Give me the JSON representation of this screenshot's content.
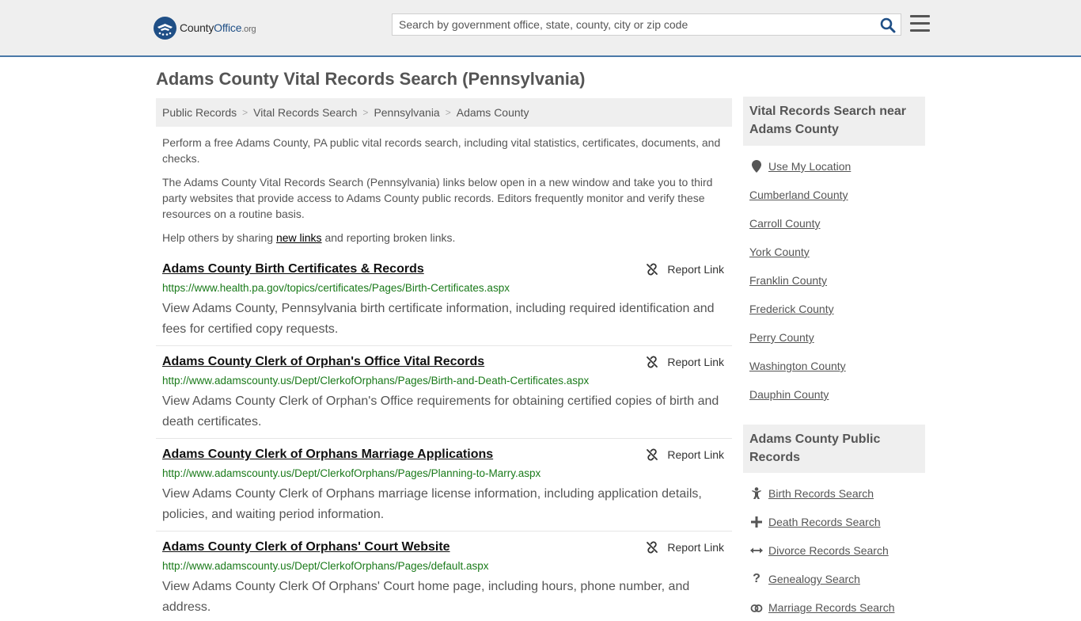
{
  "header": {
    "logo": {
      "part1": "County",
      "part2": "Office",
      "part3": ".org"
    },
    "search_placeholder": "Search by government office, state, county, city or zip code",
    "brand_color": "#1f4f86"
  },
  "page_title": "Adams County Vital Records Search (Pennsylvania)",
  "breadcrumb": [
    "Public Records",
    "Vital Records Search",
    "Pennsylvania",
    "Adams County"
  ],
  "intro": {
    "p1": "Perform a free Adams County, PA public vital records search, including vital statistics, certificates, documents, and checks.",
    "p2": "The Adams County Vital Records Search (Pennsylvania) links below open in a new window and take you to third party websites that provide access to Adams County public records. Editors frequently monitor and verify these resources on a routine basis.",
    "p3_before": "Help others by sharing ",
    "p3_link": "new links",
    "p3_after": " and reporting broken links."
  },
  "report_label": "Report Link",
  "results": [
    {
      "title": "Adams County Birth Certificates & Records",
      "url": "https://www.health.pa.gov/topics/certificates/Pages/Birth-Certificates.aspx",
      "desc": "View Adams County, Pennsylvania birth certificate information, including required identification and fees for certified copy requests."
    },
    {
      "title": "Adams County Clerk of Orphan's Office Vital Records",
      "url": "http://www.adamscounty.us/Dept/ClerkofOrphans/Pages/Birth-and-Death-Certificates.aspx",
      "desc": "View Adams County Clerk of Orphan's Office requirements for obtaining certified copies of birth and death certificates."
    },
    {
      "title": "Adams County Clerk of Orphans Marriage Applications",
      "url": "http://www.adamscounty.us/Dept/ClerkofOrphans/Pages/Planning-to-Marry.aspx",
      "desc": "View Adams County Clerk of Orphans marriage license information, including application details, policies, and waiting period information."
    },
    {
      "title": "Adams County Clerk of Orphans' Court Website",
      "url": "http://www.adamscounty.us/Dept/ClerkofOrphans/Pages/default.aspx",
      "desc": "View Adams County Clerk Of Orphans' Court home page, including hours, phone number, and address."
    }
  ],
  "sidebar": {
    "near_title": "Vital Records Search near Adams County",
    "use_location": "Use My Location",
    "near_links": [
      "Cumberland County",
      "Carroll County",
      "York County",
      "Franklin County",
      "Frederick County",
      "Perry County",
      "Washington County",
      "Dauphin County"
    ],
    "public_title": "Adams County Public Records",
    "public_links": [
      {
        "label": "Birth Records Search",
        "icon": "baby-icon"
      },
      {
        "label": "Death Records Search",
        "icon": "cross-icon"
      },
      {
        "label": "Divorce Records Search",
        "icon": "split-arrows-icon"
      },
      {
        "label": "Genealogy Search",
        "icon": "question-icon"
      },
      {
        "label": "Marriage Records Search",
        "icon": "rings-icon"
      }
    ]
  }
}
